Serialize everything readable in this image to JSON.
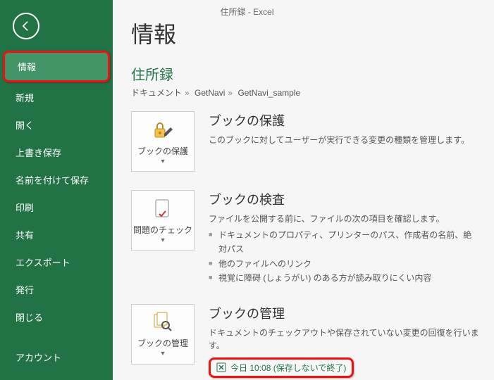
{
  "title": "住所録 - Excel",
  "sidebar": {
    "items": [
      {
        "label": "情報",
        "active": true
      },
      {
        "label": "新規"
      },
      {
        "label": "開く"
      },
      {
        "label": "上書き保存"
      },
      {
        "label": "名前を付けて保存"
      },
      {
        "label": "印刷"
      },
      {
        "label": "共有"
      },
      {
        "label": "エクスポート"
      },
      {
        "label": "発行"
      },
      {
        "label": "閉じる"
      },
      {
        "label": "アカウント"
      }
    ]
  },
  "main": {
    "page_title": "情報",
    "doc_name": "住所録",
    "breadcrumb": [
      "ドキュメント",
      "GetNavi",
      "GetNavi_sample"
    ],
    "protect": {
      "tile_label": "ブックの保護",
      "tile_drop": "▾",
      "heading": "ブックの保護",
      "text": "このブックに対してユーザーが実行できる変更の種類を管理します。"
    },
    "inspect": {
      "tile_label": "問題のチェック",
      "tile_drop": "▾",
      "heading": "ブックの検査",
      "lead": "ファイルを公開する前に、ファイルの次の項目を確認します。",
      "items": [
        "ドキュメントのプロパティ、プリンターのパス、作成者の名前、絶対パス",
        "他のファイルへのリンク",
        "視覚に障碍 (しょうがい) のある方が読み取りにくい内容"
      ]
    },
    "manage": {
      "tile_label": "ブックの管理",
      "tile_drop": "▾",
      "heading": "ブックの管理",
      "text": "ドキュメントのチェックアウトや保存されていない変更の回復を行います。",
      "version": "今日 10:08 (保存しないで終了)"
    }
  }
}
